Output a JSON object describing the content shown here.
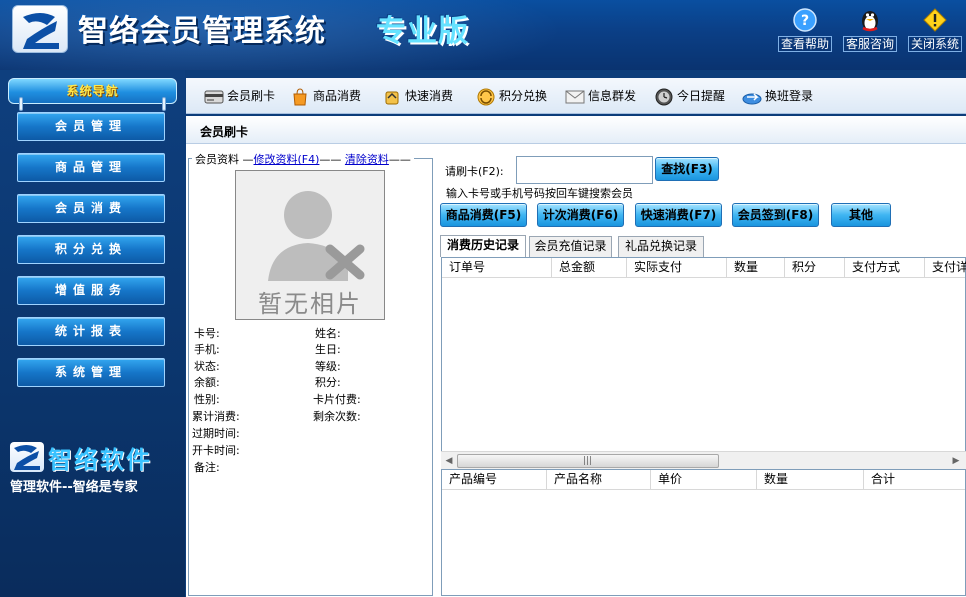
{
  "header": {
    "title": "智络会员管理系统",
    "edition": "专业版",
    "buttons": [
      {
        "label": "查看帮助",
        "icon": "help-icon"
      },
      {
        "label": "客服咨询",
        "icon": "qq-penguin-icon"
      },
      {
        "label": "关闭系统",
        "icon": "warning-icon"
      }
    ]
  },
  "sidebar": {
    "heading": "系统导航",
    "items": [
      {
        "label": "会员管理"
      },
      {
        "label": "商品管理"
      },
      {
        "label": "会员消费"
      },
      {
        "label": "积分兑换"
      },
      {
        "label": "增值服务"
      },
      {
        "label": "统计报表"
      },
      {
        "label": "系统管理"
      }
    ],
    "brand_name": "智络软件",
    "brand_slogan": "管理软件--智络是专家"
  },
  "toolbar": {
    "items": [
      {
        "label": "会员刷卡",
        "icon": "card-reader-icon"
      },
      {
        "label": "商品消费",
        "icon": "shopping-icon"
      },
      {
        "label": "快速消费",
        "icon": "fast-pay-icon"
      },
      {
        "label": "积分兑换",
        "icon": "exchange-icon"
      },
      {
        "label": "信息群发",
        "icon": "mail-icon"
      },
      {
        "label": "今日提醒",
        "icon": "clock-icon"
      },
      {
        "label": "换班登录",
        "icon": "login-icon"
      }
    ]
  },
  "panel": {
    "title": "会员刷卡",
    "member": {
      "legend": "会员资料",
      "edit_link": "修改资料(F4)",
      "clear_link": "清除资料",
      "no_photo": "暂无相片",
      "fields_left": [
        "卡号:",
        "手机:",
        "状态:",
        "余额:",
        "性别:",
        "累计消费:",
        "过期时间:",
        "开卡时间:",
        "备注:"
      ],
      "fields_right": [
        "姓名:",
        "生日:",
        "等级:",
        "积分:",
        "卡片付费:",
        "剩余次数:"
      ]
    },
    "swipe": {
      "label": "请刷卡(F2):",
      "value": "",
      "search_button": "查找(F3)",
      "hint": "输入卡号或手机号码按回车键搜索会员"
    },
    "actions": [
      "商品消费(F5)",
      "计次消费(F6)",
      "快速消费(F7)",
      "会员签到(F8)",
      "其他"
    ],
    "tabs": [
      {
        "label": "消费历史记录",
        "active": true
      },
      {
        "label": "会员充值记录",
        "active": false
      },
      {
        "label": "礼品兑换记录",
        "active": false
      }
    ],
    "history_columns": [
      "订单号",
      "总金额",
      "实际支付",
      "数量",
      "积分",
      "支付方式",
      "支付详"
    ],
    "history_rows": [],
    "detail_columns": [
      "产品编号",
      "产品名称",
      "单价",
      "数量",
      "合计"
    ],
    "detail_rows": []
  },
  "colors": {
    "header_bg": "#0b3f86",
    "sidebar_bg": "#0e3f7e",
    "nav_button": "#1676c9",
    "action_button": "#3fb5f2",
    "link": "#0000cc"
  }
}
